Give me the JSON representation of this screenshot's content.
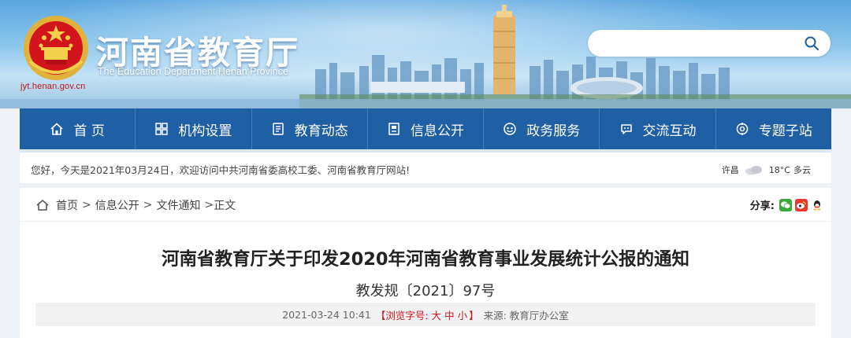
{
  "header": {
    "title": "河南省教育厅",
    "subtitle": "The Education Department Henan Province",
    "url": "jyt.henan.gov.cn",
    "search_placeholder": ""
  },
  "nav": {
    "items": [
      {
        "label": "首 页",
        "icon": "home-icon"
      },
      {
        "label": "机构设置",
        "icon": "grid-icon"
      },
      {
        "label": "教育动态",
        "icon": "news-icon"
      },
      {
        "label": "信息公开",
        "icon": "document-icon"
      },
      {
        "label": "政务服务",
        "icon": "service-icon"
      },
      {
        "label": "交流互动",
        "icon": "chat-icon"
      },
      {
        "label": "专题子站",
        "icon": "topic-icon"
      }
    ]
  },
  "notice": {
    "greeting": "您好，今天是2021年03月24日，欢迎访问中共河南省委高校工委、河南省教育厅网站!",
    "weather_city": "许昌",
    "weather_temp": "18°C",
    "weather_desc": "多云",
    "weather_icon": "cloud-icon"
  },
  "breadcrumb": {
    "items": [
      "首页",
      "信息公开",
      "文件通知"
    ],
    "current": "正文",
    "separator": ">"
  },
  "share": {
    "label": "分享:",
    "icons": [
      "wechat-icon",
      "weibo-icon",
      "qq-icon"
    ]
  },
  "article": {
    "title": "河南省教育厅关于印发2020年河南省教育事业发展统计公报的通知",
    "doc_number": "教发规〔2021〕97号",
    "date": "2021-03-24 10:41",
    "font_label": "【浏览字号:",
    "font_large": "大",
    "font_medium": "中",
    "font_small": "小",
    "font_close": "】",
    "source": "来源: 教育厅办公室"
  },
  "colors": {
    "nav_bg": "#1f5fa3",
    "accent_red": "#d1121c",
    "page_bg": "#eef1f5"
  }
}
